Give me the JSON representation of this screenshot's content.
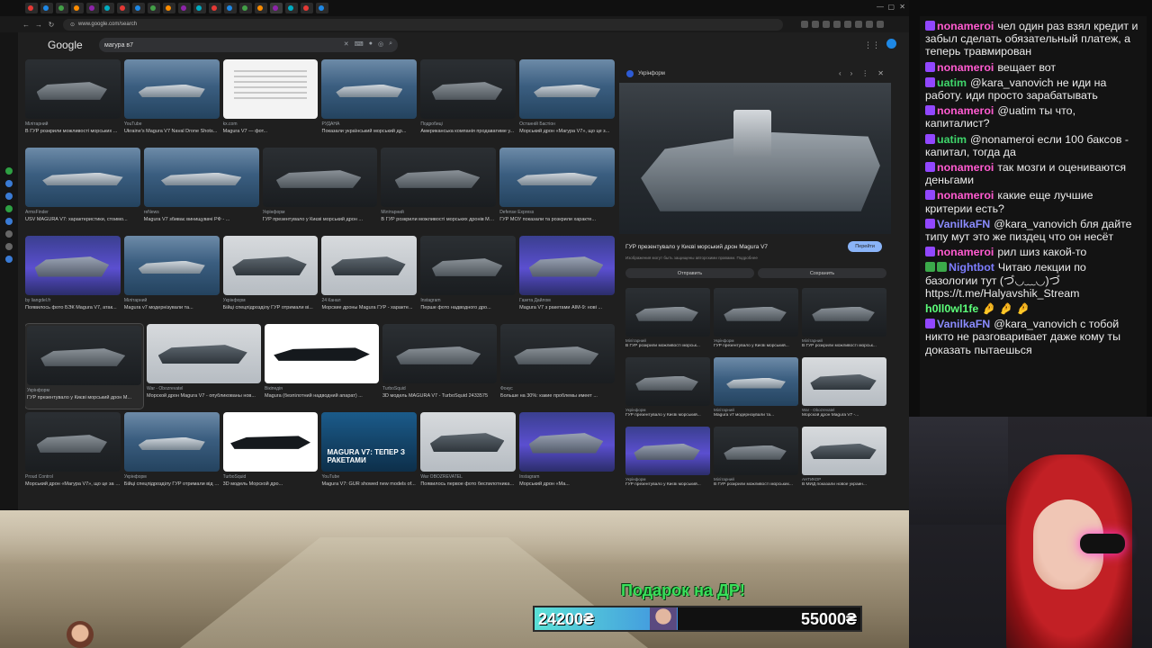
{
  "browser": {
    "url": "www.google.com/search",
    "tabs": [
      "",
      "",
      "",
      "",
      "",
      "",
      "",
      "",
      "",
      "",
      "",
      "",
      "",
      "",
      "",
      "",
      "",
      "",
      "",
      ""
    ]
  },
  "google": {
    "logo": "Google",
    "query": "магура в7"
  },
  "results": [
    [
      {
        "src": "Мілітарний",
        "cap": "В ГУР розкрили можливості морських ...",
        "style": "boat-dark"
      },
      {
        "src": "YouTube",
        "cap": "Ukraine's Magura V7 Naval Drone Shots...",
        "style": "boat-sea"
      },
      {
        "src": "kx.com",
        "cap": "Magura V7 — фот...",
        "style": "doc-thumb"
      },
      {
        "src": "РУДАНА",
        "cap": "Показали український морський др...",
        "style": "boat-sea"
      },
      {
        "src": "Подробиці",
        "cap": "Американська компанія продаватиме у...",
        "style": "boat-dark"
      },
      {
        "src": "Останній Бастіон",
        "cap": "Морський дрон «Магура V7», що це з...",
        "style": "boat-sea"
      }
    ],
    [
      {
        "src": "ArmsFinder",
        "cap": "USV MAGURA V7: характеристики, стоимо...",
        "style": "boat-sea"
      },
      {
        "src": "reNews",
        "cap": "Magura V7 збиває винищувачі РФ - ...",
        "style": "boat-sea"
      },
      {
        "src": "Укрінформ",
        "cap": "ГУР презентувало у Києві морський дрон ...",
        "style": "boat-dark"
      },
      {
        "src": "Мілітарний",
        "cap": "В ГУР розкрили можливості морських дронів Mag...",
        "style": "boat-dark"
      },
      {
        "src": "Defense Express",
        "cap": "ГУР МОУ показали та розкрили характе...",
        "style": "boat-sea"
      }
    ],
    [
      {
        "src": "by liangdel.fr",
        "cap": "Появилось фото БЭК Magura V7, атак...",
        "style": "boat-blue"
      },
      {
        "src": "Мілітарний",
        "cap": "Magura v7 модернізували та...",
        "style": "boat-sea"
      },
      {
        "src": "Укрінформ",
        "cap": "Бійці спецпідрозділу ГУР отримали ві...",
        "style": "boat-light"
      },
      {
        "src": "24 Канал",
        "cap": "Морские дроны Magura ГУР - характе...",
        "style": "boat-light"
      },
      {
        "src": "Instagram",
        "cap": "Перше фото надводного дро...",
        "style": "boat-dark"
      },
      {
        "src": "Газета Дайлом",
        "cap": "Magura V7 з ракетами AIM-9: нові ...",
        "style": "boat-blue"
      }
    ],
    [
      {
        "src": "Укрінформ",
        "cap": "ГУР презентувало у Києві морський дрон M...",
        "style": "boat-dark",
        "selected": true
      },
      {
        "src": "War - Obozrevatel",
        "cap": "Морской дрон Magura V7 - опубликованы нов...",
        "style": "boat-light"
      },
      {
        "src": "Вікіпедія",
        "cap": "Magura (безпілотний надводний апарат) ...",
        "style": "white-thumb"
      },
      {
        "src": "TurboSquid",
        "cap": "3D модель MAGURA V7 - TurboSquid 2433575",
        "style": "boat-dark"
      },
      {
        "src": "Фокус",
        "cap": "Больше на 30%: какие проблемы имеет ...",
        "style": "boat-dark"
      }
    ],
    [
      {
        "src": "Proud Control",
        "cap": "Морський дрон «Магура V7», що це за з...",
        "style": "boat-dark"
      },
      {
        "src": "Укрінформ",
        "cap": "Бійці спецпідрозділу ГУР отримали від б...",
        "style": "boat-sea"
      },
      {
        "src": "TurboSquid",
        "cap": "3D модель Морской дро...",
        "style": "white-thumb"
      },
      {
        "src": "YouTube",
        "cap": "Magura V7: GUR showed new models of...",
        "style": "poster",
        "poster": "MAGURA V7: ТЕПЕР З РАКЕТАМИ"
      },
      {
        "src": "War OBOZREVATEL",
        "cap": "Появилось первое фото беспилотника Mag...",
        "style": "boat-light"
      },
      {
        "src": "Instagram",
        "cap": "Морський дрон «Ма...",
        "style": "boat-blue"
      }
    ]
  ],
  "preview": {
    "source": "Укрінформ",
    "title": "ГУР презентувало у Києві морський дрон Magura V7",
    "visit": "Перейти",
    "note": "Изображения могут быть защищены авторскими правами. Подробнее",
    "share": "Отправить",
    "save": "Сохранить",
    "related": [
      [
        {
          "src": "Мілітарний",
          "cap": "В ГУР розкрили можливості морськ...",
          "style": "boat-dark"
        },
        {
          "src": "Укрінформ",
          "cap": "ГУР презентувало у Києві морський...",
          "style": "boat-dark"
        },
        {
          "src": "Мілітарний",
          "cap": "В ГУР розкрили можливості морськ...",
          "style": "boat-dark"
        }
      ],
      [
        {
          "src": "Укрінформ",
          "cap": "ГУР презентувало у Києві морський...",
          "style": "boat-dark"
        },
        {
          "src": "Мілітарний",
          "cap": "Magura v7 модернізували та...",
          "style": "boat-sea"
        },
        {
          "src": "War - Obozrevatel",
          "cap": "Морской дрон Magura V7 -...",
          "style": "boat-light"
        }
      ],
      [
        {
          "src": "Укрінформ",
          "cap": "ГУР презентувало у Києві морський...",
          "style": "boat-blue"
        },
        {
          "src": "Мілітарний",
          "cap": "В ГУР розкрили можливості морських...",
          "style": "boat-dark"
        },
        {
          "src": "АНТИКОР",
          "cap": "В МИД показали новое украин...",
          "style": "boat-light"
        }
      ]
    ]
  },
  "chat": [
    {
      "user": "nonameroi",
      "color": "#ff5bd0",
      "badges": [
        "p"
      ],
      "text": "чел один раз взял кредит и забыл сделать обязательный платеж, а теперь травмирован"
    },
    {
      "user": "nonameroi",
      "color": "#ff5bd0",
      "badges": [
        "p"
      ],
      "text": "вещает вот"
    },
    {
      "user": "uatim",
      "color": "#3fd66b",
      "badges": [
        "p"
      ],
      "text": "@kara_vanovich не иди на работу. иди просто зарабатывать"
    },
    {
      "user": "nonameroi",
      "color": "#ff5bd0",
      "badges": [
        "p"
      ],
      "text": "@uatim ты что, капиталист?"
    },
    {
      "user": "uatim",
      "color": "#3fd66b",
      "badges": [
        "p"
      ],
      "text": "@nonameroi если 100 баксов - капитал, тогда да"
    },
    {
      "user": "nonameroi",
      "color": "#ff5bd0",
      "badges": [
        "p"
      ],
      "text": "так мозги и оцениваются деньгами"
    },
    {
      "user": "nonameroi",
      "color": "#ff5bd0",
      "badges": [
        "p"
      ],
      "text": "какие еще лучшие критерии есть?"
    },
    {
      "user": "VanilkaFN",
      "color": "#8a8bff",
      "badges": [
        "p"
      ],
      "text": "@kara_vanovich бля дайте типу мут это же пиздец что он несёт"
    },
    {
      "user": "nonameroi",
      "color": "#ff5bd0",
      "badges": [
        "p"
      ],
      "text": "рил шиз какой-то"
    },
    {
      "user": "Nightbot",
      "color": "#7d7dff",
      "badges": [
        "g",
        "g"
      ],
      "text": "Читаю лекции по базологии тут (づ◡﹏◡)づ https://t.me/Halyavshik_Stream"
    },
    {
      "user": "h0ll0wl1fe",
      "color": "#5cff7a",
      "badges": [],
      "text": "🤌 🤌 🤌"
    },
    {
      "user": "VanilkaFN",
      "color": "#8a8bff",
      "badges": [
        "p"
      ],
      "text": "@kara_vanovich с тобой никто не разговаривает даже кому ты доказать пытаешься"
    }
  ],
  "overlay": {
    "gift_title": "Подарок на ДР!",
    "goal_current": "24200₴",
    "goal_target": "55000₴",
    "goal_fraction": 0.44,
    "accent_green": "#39e05a"
  }
}
